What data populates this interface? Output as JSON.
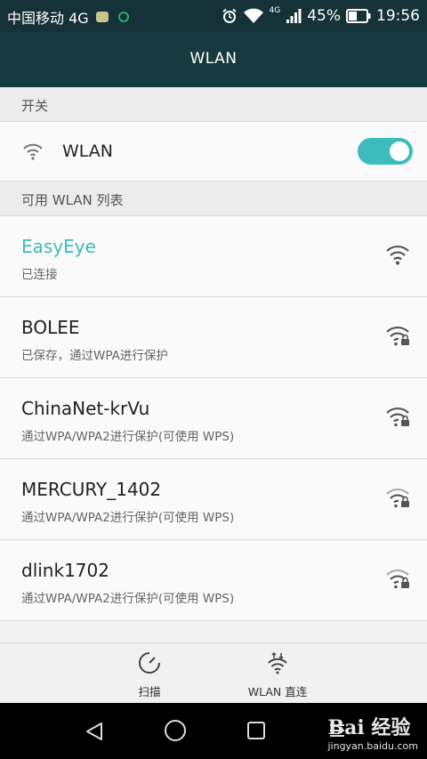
{
  "status_bar": {
    "carrier": "中国移动 4G",
    "network_type": "4G",
    "battery_percent": "45%",
    "time": "19:56"
  },
  "header": {
    "title": "WLAN"
  },
  "section_switch": {
    "label": "开关"
  },
  "wlan_toggle": {
    "label": "WLAN",
    "enabled": true
  },
  "section_list": {
    "label": "可用 WLAN 列表"
  },
  "networks": [
    {
      "name": "EasyEye",
      "status": "已连接",
      "connected": true,
      "secured": false
    },
    {
      "name": "BOLEE",
      "status": "已保存，通过WPA进行保护",
      "connected": false,
      "secured": true
    },
    {
      "name": "ChinaNet-krVu",
      "status": "通过WPA/WPA2进行保护(可使用 WPS)",
      "connected": false,
      "secured": true
    },
    {
      "name": "MERCURY_1402",
      "status": "通过WPA/WPA2进行保护(可使用 WPS)",
      "connected": false,
      "secured": true
    },
    {
      "name": "dlink1702",
      "status": "通过WPA/WPA2进行保护(可使用 WPS)",
      "connected": false,
      "secured": true
    }
  ],
  "bottom_bar": {
    "scan_label": "扫描",
    "direct_label": "WLAN 直连"
  },
  "watermark": {
    "logo": "Bai 经验",
    "url": "jingyan.baidu.com"
  },
  "colors": {
    "accent": "#3dbcbe",
    "header_bg": "#163a40",
    "status_bg": "#143238"
  }
}
